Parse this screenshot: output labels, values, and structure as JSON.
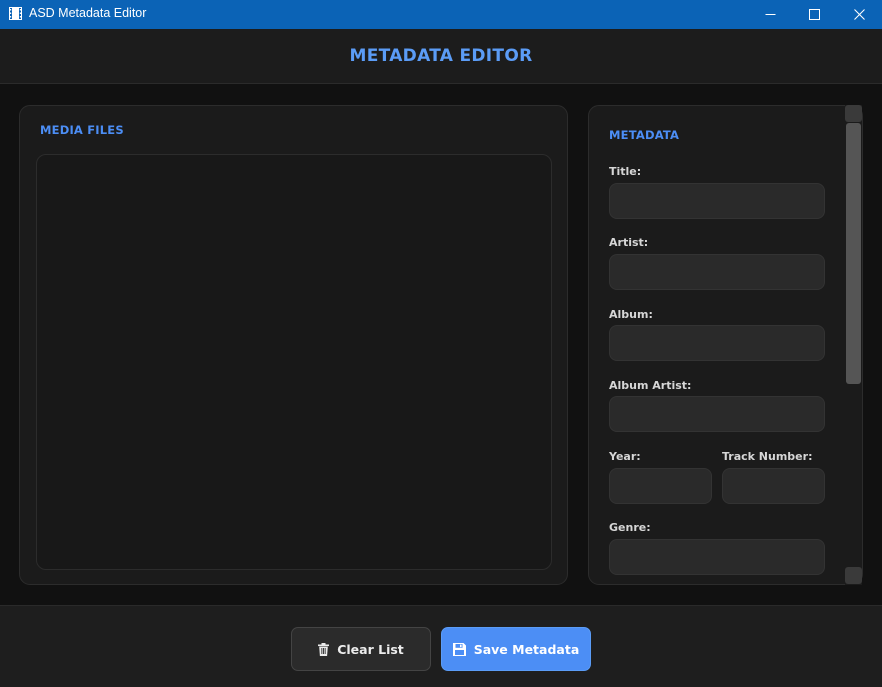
{
  "window": {
    "title": "ASD Metadata Editor"
  },
  "header": {
    "title": "METADATA EDITOR"
  },
  "media_panel": {
    "heading": "MEDIA FILES",
    "files": []
  },
  "metadata_panel": {
    "heading": "METADATA",
    "fields": {
      "title": {
        "label": "Title:",
        "value": ""
      },
      "artist": {
        "label": "Artist:",
        "value": ""
      },
      "album": {
        "label": "Album:",
        "value": ""
      },
      "album_artist": {
        "label": "Album Artist:",
        "value": ""
      },
      "year": {
        "label": "Year:",
        "value": ""
      },
      "track_number": {
        "label": "Track Number:",
        "value": ""
      },
      "genre": {
        "label": "Genre:",
        "value": ""
      }
    }
  },
  "footer": {
    "clear_label": "Clear List",
    "save_label": "Save Metadata",
    "clear_icon": "trash-icon",
    "save_icon": "floppy-disk-icon"
  },
  "colors": {
    "titlebar": "#0b63b6",
    "accent": "#4c8ef5",
    "panel_bg": "#1b1b1b",
    "input_bg": "#2a2a2a"
  }
}
